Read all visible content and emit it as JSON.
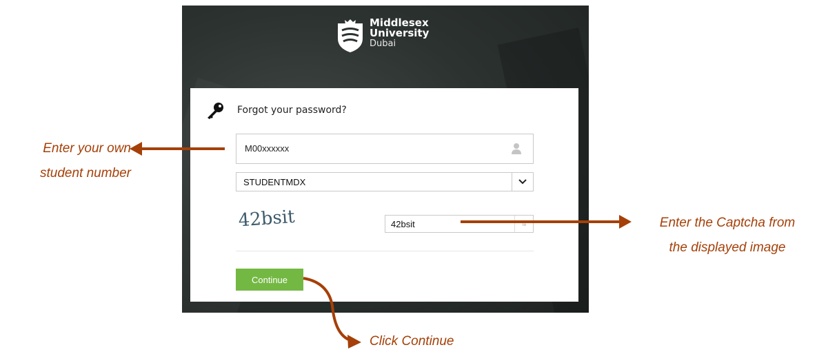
{
  "brand": {
    "line1": "Middlesex",
    "line2": "University",
    "line3": "Dubai"
  },
  "form": {
    "title": "Forgot your password?",
    "username_value": "M00xxxxxx",
    "domain_selected": "STUDENTMDX",
    "captcha_image_text": "42bsit",
    "captcha_value": "42bsit",
    "continue_label": "Continue"
  },
  "annotations": {
    "left_line1": "Enter your own",
    "left_line2": "student number",
    "right_line1": "Enter the Captcha from",
    "right_line2": "the displayed image",
    "bottom": "Click Continue"
  },
  "colors": {
    "annotation": "#a54008",
    "button": "#74b844",
    "background_dark": "#2c3230"
  }
}
